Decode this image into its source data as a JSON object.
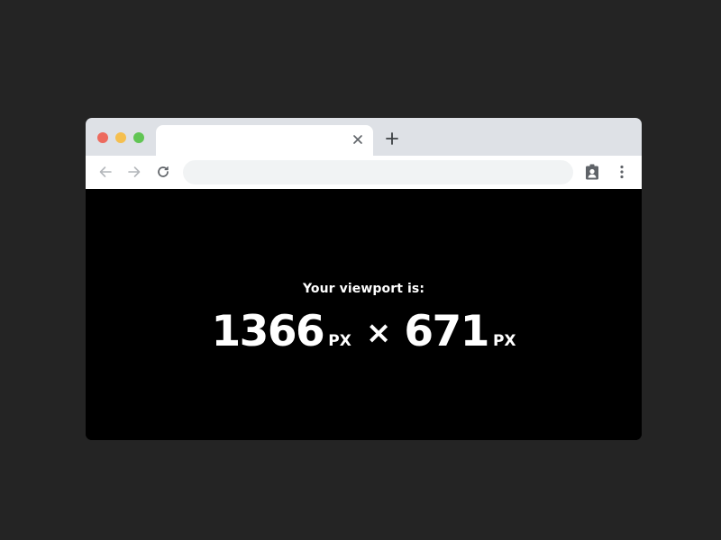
{
  "window": {
    "traffic_lights": {
      "close_color": "#ed6a5e",
      "minimize_color": "#f5bf4f",
      "maximize_color": "#61c554"
    },
    "tab": {
      "title": "",
      "close_icon": "close-icon"
    },
    "new_tab_icon": "plus-icon"
  },
  "toolbar": {
    "back_icon": "arrow-left-icon",
    "forward_icon": "arrow-right-icon",
    "reload_icon": "reload-icon",
    "address_value": "",
    "profile_icon": "profile-badge-icon",
    "menu_icon": "kebab-menu-icon"
  },
  "content": {
    "label": "Your viewport is:",
    "width": "1366",
    "height": "671",
    "unit": "PX",
    "separator": "×",
    "background": "#000000",
    "text_color": "#ffffff"
  }
}
